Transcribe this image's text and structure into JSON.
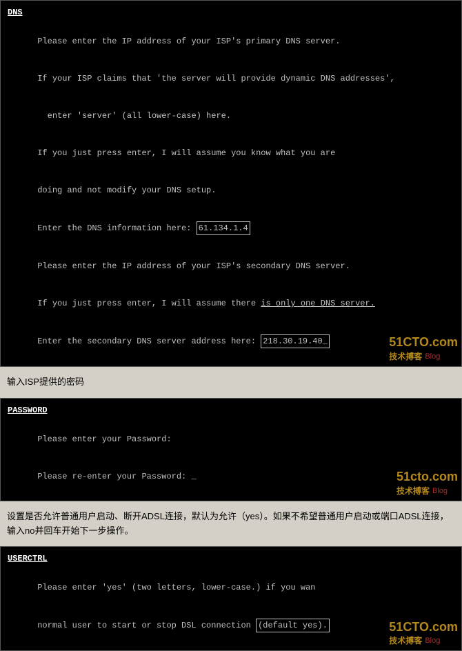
{
  "dns_section": {
    "title": "DNS",
    "lines": [
      "Please enter the IP address of your ISP's primary DNS server.",
      "If your ISP claims that 'the server will provide dynamic DNS addresses',",
      "  enter 'server' (all lower-case) here.",
      "If you just press enter, I will assume you know what you are",
      "doing and not modify your DNS setup.",
      "Enter the DNS information here: ",
      "Please enter the IP address of your ISP's secondary DNS server.",
      "If you just press enter, I will assume there ",
      "Enter the secondary DNS server address here: "
    ],
    "primary_dns_value": "61.134.1.4",
    "secondary_dns_underline": "is only one DNS server.",
    "secondary_dns_value": "218.30.19.40_",
    "watermark_51cto": "51CTO.com",
    "watermark_tech": "技术搏客",
    "watermark_blog": "Blog"
  },
  "dns_description": "输入ISP提供的密码",
  "password_section": {
    "title": "PASSWORD",
    "lines": [
      "Please enter your Password:",
      "Please re-enter your Password: _"
    ],
    "watermark_51cto": "51cto.com",
    "watermark_tech": "技术搏客",
    "watermark_blog": "Blog"
  },
  "password_description": "设置是否允许普通用户启动、断开ADSL连接，默认为允许（yes）。如果不希望普通用户启动或端口ADSL连接，输入no并回车开始下一步操作。",
  "userctrl_section": {
    "title": "USERCTRL",
    "lines": [
      "Please enter 'yes' (two letters, lower-case.) if you wan",
      "normal user to start or stop DSL connection "
    ],
    "boxed_text": "(default yes).",
    "watermark_51cto": "51CTO.com",
    "watermark_tech": "技术搏客",
    "watermark_blog": "Blog"
  }
}
